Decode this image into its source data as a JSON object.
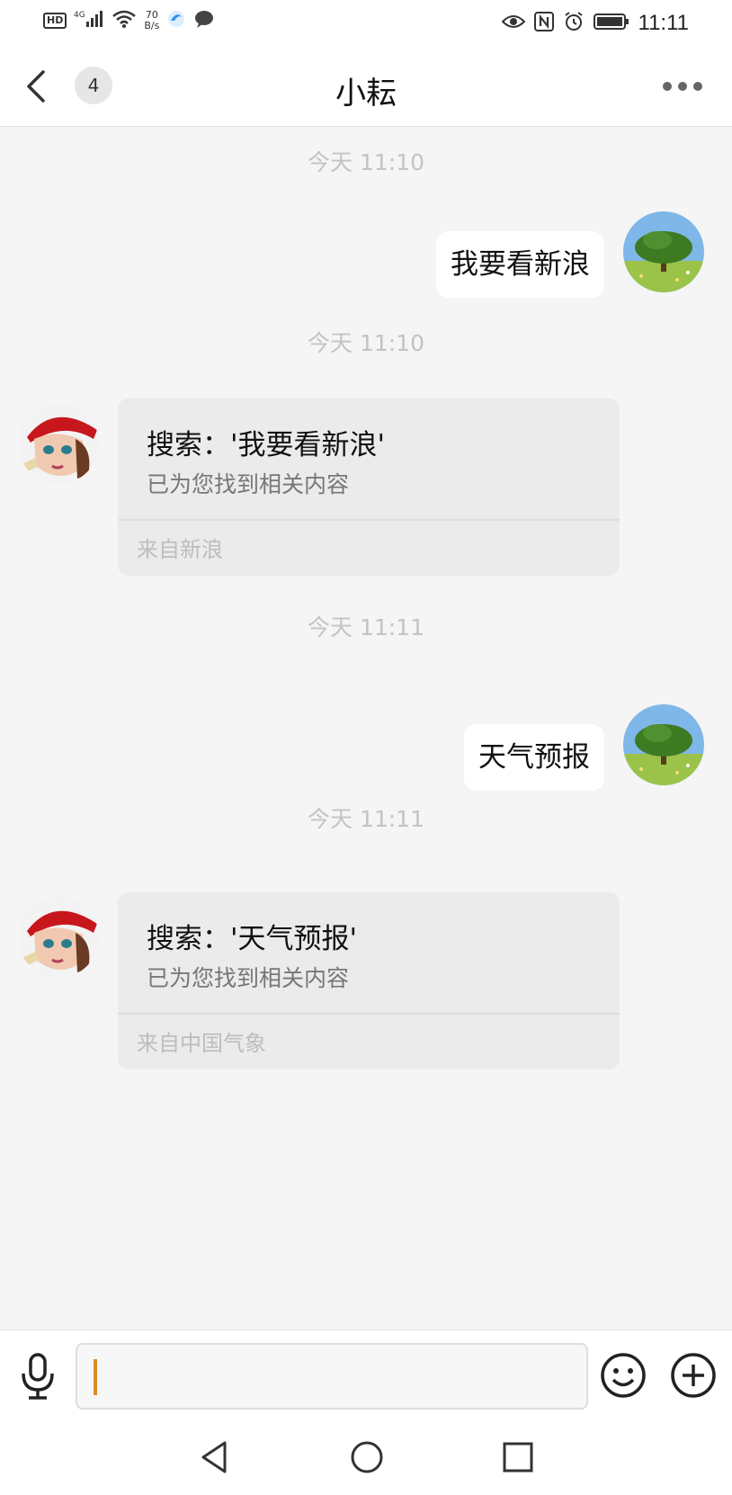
{
  "status_bar": {
    "hd_label": "HD",
    "network_type": "4G",
    "speed_value": "70",
    "speed_unit": "B/s",
    "time": "11:11",
    "icons": [
      "hd-icon",
      "signal-icon",
      "wifi-icon",
      "browser-icon",
      "chat-notification-icon",
      "eye-icon",
      "nfc-icon",
      "alarm-icon",
      "battery-icon"
    ]
  },
  "header": {
    "back_icon": "chevron-left-icon",
    "unread_count": "4",
    "title": "小耘",
    "more_icon": "more-dots-icon"
  },
  "messages": [
    {
      "type": "timestamp",
      "text": "今天 11:10"
    },
    {
      "type": "user",
      "text": "我要看新浪",
      "avatar": "tree-avatar"
    },
    {
      "type": "timestamp",
      "text": "今天 11:10"
    },
    {
      "type": "bot",
      "title": "搜索：'我要看新浪'",
      "subtitle": "已为您找到相关内容",
      "source": "来自新浪",
      "avatar": "girl-avatar"
    },
    {
      "type": "timestamp",
      "text": "今天 11:11"
    },
    {
      "type": "user",
      "text": "天气预报",
      "avatar": "tree-avatar"
    },
    {
      "type": "timestamp",
      "text": "今天 11:11"
    },
    {
      "type": "bot",
      "title": "搜索：'天气预报'",
      "subtitle": "已为您找到相关内容",
      "source": "来自中国气象",
      "avatar": "girl-avatar"
    }
  ],
  "input_bar": {
    "value": "",
    "icons": [
      "microphone-icon",
      "emoji-icon",
      "plus-icon"
    ],
    "caret_color": "#e08a2e"
  },
  "nav_bar": {
    "icons": [
      "nav-back-icon",
      "nav-home-icon",
      "nav-recent-icon"
    ]
  },
  "colors": {
    "background": "#f5f5f5",
    "bubble_user": "#ffffff",
    "card_bot": "#ebebeb",
    "timestamp": "#c3c3c3"
  }
}
